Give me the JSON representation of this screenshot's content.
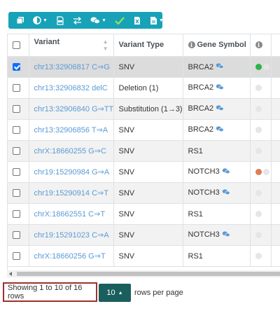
{
  "colors": {
    "toolbar_bg": "#17a2b8",
    "link": "#5b9bd5",
    "selected_row": "#dcdcdc",
    "page_size_bg": "#1b5e5e",
    "highlight_border": "#a0302a",
    "dot_green": "#2db34a",
    "dot_orange": "#e07b53",
    "dot_grey": "#e6e6e6"
  },
  "toolbar": {
    "buttons": [
      {
        "icon": "copy-icon",
        "dropdown": false
      },
      {
        "icon": "contrast-icon",
        "dropdown": true
      },
      {
        "icon": "csv-file-icon",
        "dropdown": false
      },
      {
        "icon": "swap-arrows-icon",
        "dropdown": false
      },
      {
        "icon": "comments-icon",
        "dropdown": true
      },
      {
        "icon": "checkmark-icon",
        "dropdown": false
      },
      {
        "icon": "excel-file-icon",
        "dropdown": false
      },
      {
        "icon": "document-icon",
        "dropdown": true
      }
    ]
  },
  "table": {
    "columns": [
      "Variant",
      "Variant Type",
      "Gene Symbol",
      ""
    ],
    "rows": [
      {
        "variant": "chr13:32906817 C⇒G",
        "type": "SNV",
        "gene": "BRCA2",
        "comment": true,
        "selected": true,
        "dots": [
          "green",
          "grey"
        ]
      },
      {
        "variant": "chr13:32906832 delC",
        "type": "Deletion (1)",
        "gene": "BRCA2",
        "comment": true,
        "selected": false,
        "dots": [
          "grey"
        ]
      },
      {
        "variant": "chr13:32906840 G⇒TTT",
        "type": "Substitution (1→3)",
        "gene": "BRCA2",
        "comment": true,
        "selected": false,
        "dots": [
          "grey"
        ]
      },
      {
        "variant": "chr13:32906856 T⇒A",
        "type": "SNV",
        "gene": "BRCA2",
        "comment": true,
        "selected": false,
        "dots": [
          "grey"
        ]
      },
      {
        "variant": "chrX:18660255 G⇒C",
        "type": "SNV",
        "gene": "RS1",
        "comment": false,
        "selected": false,
        "dots": [
          "grey"
        ]
      },
      {
        "variant": "chr19:15290984 G⇒A",
        "type": "SNV",
        "gene": "NOTCH3",
        "comment": true,
        "selected": false,
        "dots": [
          "orange",
          "grey"
        ]
      },
      {
        "variant": "chr19:15290914 C⇒T",
        "type": "SNV",
        "gene": "NOTCH3",
        "comment": true,
        "selected": false,
        "dots": [
          "grey"
        ]
      },
      {
        "variant": "chrX:18662551 C⇒T",
        "type": "SNV",
        "gene": "RS1",
        "comment": false,
        "selected": false,
        "dots": [
          "grey"
        ]
      },
      {
        "variant": "chr19:15291023 C⇒A",
        "type": "SNV",
        "gene": "NOTCH3",
        "comment": true,
        "selected": false,
        "dots": [
          "grey"
        ]
      },
      {
        "variant": "chrX:18660256 G⇒T",
        "type": "SNV",
        "gene": "RS1",
        "comment": false,
        "selected": false,
        "dots": [
          "grey"
        ]
      }
    ]
  },
  "pagination": {
    "summary": "Showing 1 to 10 of 16 rows",
    "page_size": "10",
    "rows_per_page_label": "rows per page"
  }
}
